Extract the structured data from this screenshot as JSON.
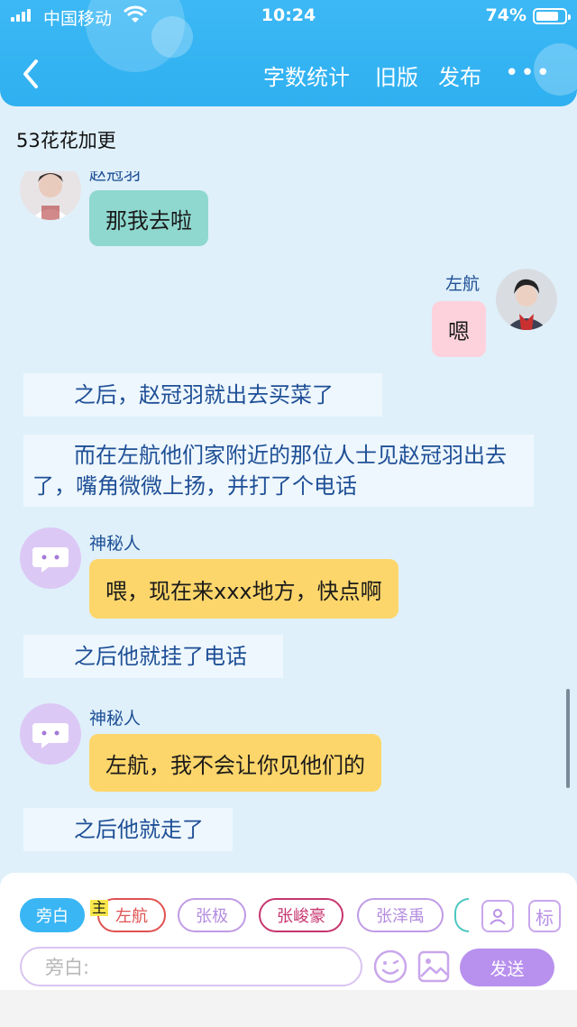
{
  "status_bar": {
    "carrier": "中国移动",
    "time": "10:24",
    "battery": "74%"
  },
  "header": {
    "actions": [
      "字数统计",
      "旧版",
      "发布"
    ],
    "more": "•••"
  },
  "chapter": {
    "title": "53花花加更"
  },
  "chat": {
    "items": [
      {
        "type": "message",
        "side": "left",
        "speaker": "赵冠羽",
        "text": "那我去啦",
        "bubble_color": "#8fd8cf"
      },
      {
        "type": "message",
        "side": "right",
        "speaker": "左航",
        "text": "嗯",
        "bubble_color": "#fdd2dc"
      },
      {
        "type": "narration",
        "text": "之后，赵冠羽就出去买菜了"
      },
      {
        "type": "narration",
        "text": "而在左航他们家附近的那位人士见赵冠羽出去了，嘴角微微上扬，并打了个电话"
      },
      {
        "type": "message",
        "side": "left",
        "speaker": "神秘人",
        "text": "喂，现在来xxx地方，快点啊",
        "bubble_color": "#fdd66b"
      },
      {
        "type": "narration",
        "text": "之后他就挂了电话"
      },
      {
        "type": "message",
        "side": "left",
        "speaker": "神秘人",
        "text": "左航，我不会让你见他们的",
        "bubble_color": "#fdd66b"
      },
      {
        "type": "narration",
        "text": "之后他就走了"
      }
    ]
  },
  "composer": {
    "roles": [
      {
        "label": "旁白",
        "color": "#3ab6f4",
        "selected": true
      },
      {
        "label": "左航",
        "color": "#e05252"
      },
      {
        "label": "张极",
        "color": "#c09be6"
      },
      {
        "label": "张峻豪",
        "color": "#c7366f"
      },
      {
        "label": "张泽禹",
        "color": "#c09be6"
      }
    ],
    "host_tag": "主",
    "tag_button": "标",
    "input_placeholder": "旁白:",
    "send_label": "发送"
  }
}
